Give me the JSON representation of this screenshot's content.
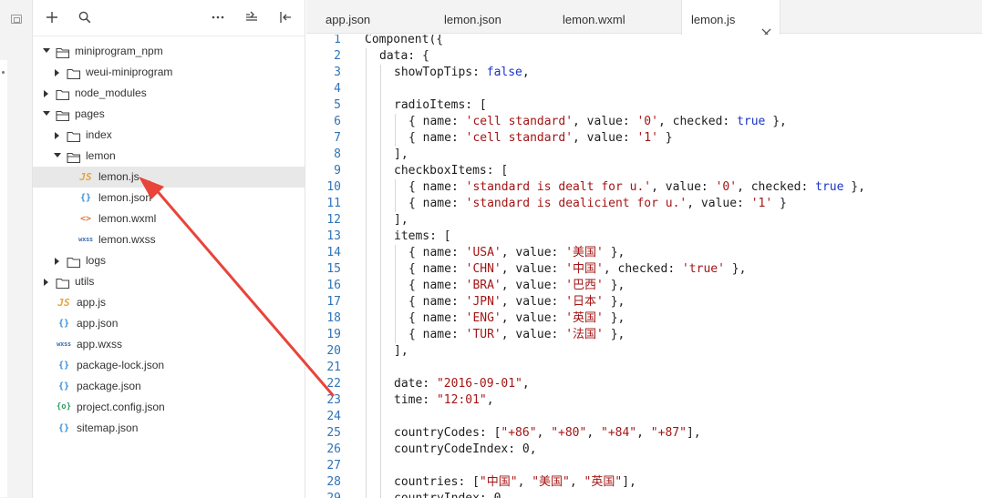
{
  "toolbar": {
    "icons": [
      "plus-icon",
      "search-icon",
      "more-icon",
      "collapse-tree-icon",
      "split-panel-icon"
    ]
  },
  "tree": [
    {
      "label": "miniprogram_npm",
      "type": "folder",
      "open": true,
      "depth": 0
    },
    {
      "label": "weui-miniprogram",
      "type": "folder",
      "open": false,
      "depth": 1
    },
    {
      "label": "node_modules",
      "type": "folder",
      "open": false,
      "depth": 0
    },
    {
      "label": "pages",
      "type": "folder",
      "open": true,
      "depth": 0
    },
    {
      "label": "index",
      "type": "folder",
      "open": false,
      "depth": 1
    },
    {
      "label": "lemon",
      "type": "folder",
      "open": true,
      "depth": 1
    },
    {
      "label": "lemon.js",
      "type": "js",
      "icon": "JS",
      "depth": 2,
      "selected": true
    },
    {
      "label": "lemon.json",
      "type": "json",
      "icon": "{}",
      "depth": 2
    },
    {
      "label": "lemon.wxml",
      "type": "wxml",
      "icon": "<>",
      "depth": 2
    },
    {
      "label": "lemon.wxss",
      "type": "wxss",
      "icon": "wxss",
      "depth": 2
    },
    {
      "label": "logs",
      "type": "folder",
      "open": false,
      "depth": 1
    },
    {
      "label": "utils",
      "type": "folder",
      "open": false,
      "depth": 0
    },
    {
      "label": "app.js",
      "type": "js",
      "icon": "JS",
      "depth": 0
    },
    {
      "label": "app.json",
      "type": "json",
      "icon": "{}",
      "depth": 0
    },
    {
      "label": "app.wxss",
      "type": "wxss",
      "icon": "wxss",
      "depth": 0
    },
    {
      "label": "package-lock.json",
      "type": "json",
      "icon": "{}",
      "depth": 0
    },
    {
      "label": "package.json",
      "type": "json",
      "icon": "{}",
      "depth": 0
    },
    {
      "label": "project.config.json",
      "type": "cfg",
      "icon": "{o}",
      "depth": 0
    },
    {
      "label": "sitemap.json",
      "type": "json",
      "icon": "{}",
      "depth": 0
    }
  ],
  "tabs": [
    {
      "label": "app.json",
      "active": false
    },
    {
      "label": "lemon.json",
      "active": false
    },
    {
      "label": "lemon.wxml",
      "active": false
    },
    {
      "label": "lemon.js",
      "active": true
    }
  ],
  "code": [
    {
      "n": "1",
      "indent": 0,
      "t": [
        [
          "Component({",
          ""
        ]
      ]
    },
    {
      "n": "2",
      "indent": 1,
      "t": [
        [
          "data: {",
          ""
        ]
      ]
    },
    {
      "n": "3",
      "indent": 2,
      "t": [
        [
          "showTopTips: ",
          ""
        ],
        [
          "false",
          "kw"
        ],
        [
          ",",
          ""
        ]
      ]
    },
    {
      "n": "4",
      "indent": 2,
      "t": []
    },
    {
      "n": "5",
      "indent": 2,
      "t": [
        [
          "radioItems: [",
          ""
        ]
      ]
    },
    {
      "n": "6",
      "indent": 3,
      "t": [
        [
          "{ name: ",
          ""
        ],
        [
          "'cell standard'",
          "str"
        ],
        [
          ", value: ",
          ""
        ],
        [
          "'0'",
          "str"
        ],
        [
          ", checked: ",
          ""
        ],
        [
          "true",
          "kw"
        ],
        [
          " },",
          ""
        ]
      ]
    },
    {
      "n": "7",
      "indent": 3,
      "t": [
        [
          "{ name: ",
          ""
        ],
        [
          "'cell standard'",
          "str"
        ],
        [
          ", value: ",
          ""
        ],
        [
          "'1'",
          "str"
        ],
        [
          " }",
          ""
        ]
      ]
    },
    {
      "n": "8",
      "indent": 2,
      "t": [
        [
          "],",
          ""
        ]
      ]
    },
    {
      "n": "9",
      "indent": 2,
      "t": [
        [
          "checkboxItems: [",
          ""
        ]
      ]
    },
    {
      "n": "10",
      "indent": 3,
      "t": [
        [
          "{ name: ",
          ""
        ],
        [
          "'standard is dealt for u.'",
          "str"
        ],
        [
          ", value: ",
          ""
        ],
        [
          "'0'",
          "str"
        ],
        [
          ", checked: ",
          ""
        ],
        [
          "true",
          "kw"
        ],
        [
          " },",
          ""
        ]
      ]
    },
    {
      "n": "11",
      "indent": 3,
      "t": [
        [
          "{ name: ",
          ""
        ],
        [
          "'standard is dealicient for u.'",
          "str"
        ],
        [
          ", value: ",
          ""
        ],
        [
          "'1'",
          "str"
        ],
        [
          " }",
          ""
        ]
      ]
    },
    {
      "n": "12",
      "indent": 2,
      "t": [
        [
          "],",
          ""
        ]
      ]
    },
    {
      "n": "13",
      "indent": 2,
      "t": [
        [
          "items: [",
          ""
        ]
      ]
    },
    {
      "n": "14",
      "indent": 3,
      "t": [
        [
          "{ name: ",
          ""
        ],
        [
          "'USA'",
          "str"
        ],
        [
          ", value: ",
          ""
        ],
        [
          "'美国'",
          "str"
        ],
        [
          " },",
          ""
        ]
      ]
    },
    {
      "n": "15",
      "indent": 3,
      "t": [
        [
          "{ name: ",
          ""
        ],
        [
          "'CHN'",
          "str"
        ],
        [
          ", value: ",
          ""
        ],
        [
          "'中国'",
          "str"
        ],
        [
          ", checked: ",
          ""
        ],
        [
          "'true'",
          "str"
        ],
        [
          " },",
          ""
        ]
      ]
    },
    {
      "n": "16",
      "indent": 3,
      "t": [
        [
          "{ name: ",
          ""
        ],
        [
          "'BRA'",
          "str"
        ],
        [
          ", value: ",
          ""
        ],
        [
          "'巴西'",
          "str"
        ],
        [
          " },",
          ""
        ]
      ]
    },
    {
      "n": "17",
      "indent": 3,
      "t": [
        [
          "{ name: ",
          ""
        ],
        [
          "'JPN'",
          "str"
        ],
        [
          ", value: ",
          ""
        ],
        [
          "'日本'",
          "str"
        ],
        [
          " },",
          ""
        ]
      ]
    },
    {
      "n": "18",
      "indent": 3,
      "t": [
        [
          "{ name: ",
          ""
        ],
        [
          "'ENG'",
          "str"
        ],
        [
          ", value: ",
          ""
        ],
        [
          "'英国'",
          "str"
        ],
        [
          " },",
          ""
        ]
      ]
    },
    {
      "n": "19",
      "indent": 3,
      "t": [
        [
          "{ name: ",
          ""
        ],
        [
          "'TUR'",
          "str"
        ],
        [
          ", value: ",
          ""
        ],
        [
          "'法国'",
          "str"
        ],
        [
          " },",
          ""
        ]
      ]
    },
    {
      "n": "20",
      "indent": 2,
      "t": [
        [
          "],",
          ""
        ]
      ]
    },
    {
      "n": "21",
      "indent": 2,
      "t": []
    },
    {
      "n": "22",
      "indent": 2,
      "t": [
        [
          "date: ",
          ""
        ],
        [
          "\"2016-09-01\"",
          "str"
        ],
        [
          ",",
          ""
        ]
      ]
    },
    {
      "n": "23",
      "indent": 2,
      "t": [
        [
          "time: ",
          ""
        ],
        [
          "\"12:01\"",
          "str"
        ],
        [
          ",",
          ""
        ]
      ]
    },
    {
      "n": "24",
      "indent": 2,
      "t": []
    },
    {
      "n": "25",
      "indent": 2,
      "t": [
        [
          "countryCodes: [",
          ""
        ],
        [
          "\"+86\"",
          "str"
        ],
        [
          ", ",
          ""
        ],
        [
          "\"+80\"",
          "str"
        ],
        [
          ", ",
          ""
        ],
        [
          "\"+84\"",
          "str"
        ],
        [
          ", ",
          ""
        ],
        [
          "\"+87\"",
          "str"
        ],
        [
          "],",
          ""
        ]
      ]
    },
    {
      "n": "26",
      "indent": 2,
      "t": [
        [
          "countryCodeIndex: 0,",
          ""
        ]
      ]
    },
    {
      "n": "27",
      "indent": 2,
      "t": []
    },
    {
      "n": "28",
      "indent": 2,
      "t": [
        [
          "countries: [",
          ""
        ],
        [
          "\"中国\"",
          "str"
        ],
        [
          ", ",
          ""
        ],
        [
          "\"美国\"",
          "str"
        ],
        [
          ", ",
          ""
        ],
        [
          "\"英国\"",
          "str"
        ],
        [
          "],",
          ""
        ]
      ]
    },
    {
      "n": "29",
      "indent": 2,
      "t": [
        [
          "countryIndex: 0,",
          ""
        ]
      ]
    }
  ],
  "colors": {
    "keyword": "#1a33c9",
    "string": "#a31515",
    "line_number": "#2f74b8",
    "annotation_arrow": "#e8443a",
    "selected_row": "#e8e8e8"
  }
}
